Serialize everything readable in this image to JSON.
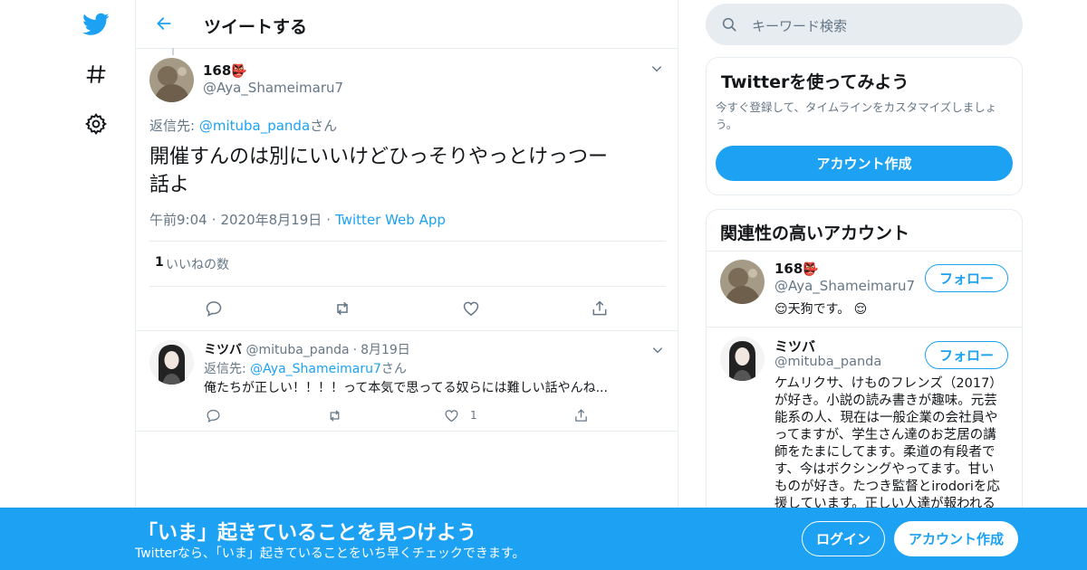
{
  "colors": {
    "accent": "#1da1f2",
    "border": "#e6ecf0",
    "muted": "#657786"
  },
  "nav": [
    {
      "icon": "twitter-bird-icon"
    },
    {
      "icon": "hashtag-icon"
    },
    {
      "icon": "gear-icon"
    }
  ],
  "header": {
    "title": "ツイートする",
    "back_icon": "arrow-left-icon"
  },
  "tweet": {
    "name": "168",
    "name_emoji": "👺",
    "handle": "@Aya_Shameimaru7",
    "reply_prefix": "返信先: ",
    "reply_to": "@mituba_panda",
    "reply_suffix": "さん",
    "text_line1": "開催すんのは別にいいけどひっそりやっとけっつー",
    "text_line2": "話よ",
    "time": "午前9:04",
    "date": "2020年8月19日",
    "source": "Twitter Web App",
    "likes_count": "1",
    "likes_label": "いいねの数"
  },
  "reply": {
    "name": "ミツバ",
    "handle": "@mituba_panda",
    "date": "8月19日",
    "reply_prefix": "返信先: ",
    "reply_to": "@Aya_Shameimaru7",
    "reply_suffix": "さん",
    "text": "俺たちが正しい！！！！って本気で思ってる奴らには難しい話やんね...",
    "like_count": "1"
  },
  "search": {
    "placeholder": "キーワード検索"
  },
  "signup_card": {
    "title": "Twitterを使ってみよう",
    "desc_line1": "今すぐ登録して、タイムラインをカスタマイズしましょ",
    "desc_line2": "う。",
    "button": "アカウント作成"
  },
  "related": {
    "title": "関連性の高いアカウント",
    "accounts": [
      {
        "name": "168",
        "name_emoji": "👺",
        "handle": "@Aya_Shameimaru7",
        "bio": "天狗です。",
        "bio_emoji": "😌",
        "follow": "フォロー"
      },
      {
        "name": "ミツバ",
        "handle": "@mituba_panda",
        "bio_lines": [
          "ケムリクサ、けものフレンズ（2017）",
          "が好き。小説の読み書きが趣味。元芸",
          "能系の人、現在は一般企業の会社員や",
          "ってますが、学生さん達のお芝居の講",
          "師をたまにしてます。柔道の有段者で",
          "す、今はボクシングやってます。甘い",
          "ものが好き。たつき監督とirodoriを応",
          "援しています。正しい人達が報われる"
        ],
        "follow": "フォロー"
      }
    ]
  },
  "banner": {
    "title": "「いま」起きていることを見つけよう",
    "subtitle": "Twitterなら、「いま」起きていることをいち早くチェックできます。",
    "login": "ログイン",
    "signup": "アカウント作成"
  }
}
